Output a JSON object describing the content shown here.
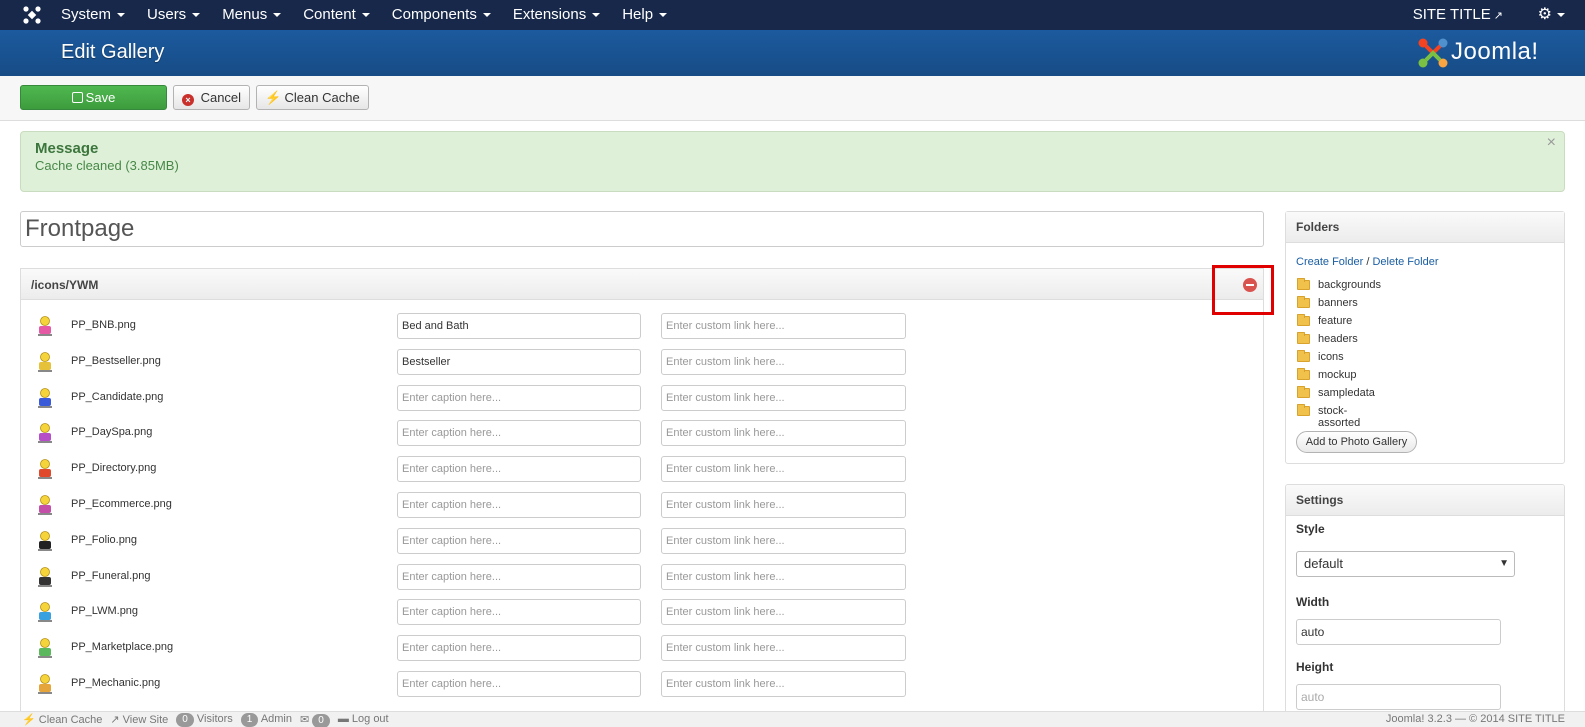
{
  "navbar": {
    "logo_icon": "joomla-icon",
    "menu": [
      "System",
      "Users",
      "Menus",
      "Content",
      "Components",
      "Extensions",
      "Help"
    ],
    "site_title": "SITE TITLE",
    "settings_icon": "gear-icon"
  },
  "header": {
    "title": "Edit Gallery",
    "brand": "Joomla!"
  },
  "toolbar": {
    "save_label": "Save",
    "cancel_label": "Cancel",
    "clean_cache_label": "Clean Cache"
  },
  "message": {
    "title": "Message",
    "text": "Cache cleaned (3.85MB)",
    "close": "×"
  },
  "gallery": {
    "title": "Frontpage",
    "folder_path": "/icons/YWM",
    "caption_placeholder": "Enter caption here...",
    "link_placeholder": "Enter custom link here...",
    "items": [
      {
        "file": "PP_BNB.png",
        "caption": "Bed and Bath",
        "link": "",
        "color": "#e65aa5"
      },
      {
        "file": "PP_Bestseller.png",
        "caption": "Bestseller",
        "link": "",
        "color": "#e6c23a"
      },
      {
        "file": "PP_Candidate.png",
        "caption": "",
        "link": "",
        "color": "#3a5bd9"
      },
      {
        "file": "PP_DaySpa.png",
        "caption": "",
        "link": "",
        "color": "#b64fc7"
      },
      {
        "file": "PP_Directory.png",
        "caption": "",
        "link": "",
        "color": "#e0492c"
      },
      {
        "file": "PP_Ecommerce.png",
        "caption": "",
        "link": "",
        "color": "#c44fa8"
      },
      {
        "file": "PP_Folio.png",
        "caption": "",
        "link": "",
        "color": "#222222"
      },
      {
        "file": "PP_Funeral.png",
        "caption": "",
        "link": "",
        "color": "#333333"
      },
      {
        "file": "PP_LWM.png",
        "caption": "",
        "link": "",
        "color": "#3aa1e0"
      },
      {
        "file": "PP_Marketplace.png",
        "caption": "",
        "link": "",
        "color": "#5cb85c"
      },
      {
        "file": "PP_Mechanic.png",
        "caption": "",
        "link": "",
        "color": "#e6a53a"
      }
    ]
  },
  "folders_panel": {
    "title": "Folders",
    "create_label": "Create Folder",
    "separator": "/",
    "delete_label": "Delete Folder",
    "folders": [
      "backgrounds",
      "banners",
      "feature",
      "headers",
      "icons",
      "mockup",
      "sampledata",
      "stock-assorted"
    ],
    "add_button": "Add to Photo Gallery"
  },
  "settings_panel": {
    "title": "Settings",
    "style_label": "Style",
    "style_value": "default",
    "width_label": "Width",
    "width_value": "auto",
    "height_label": "Height",
    "height_placeholder": "auto"
  },
  "statusbar": {
    "clean_cache": "Clean Cache",
    "view_site": "View Site",
    "visitors_count": "0",
    "visitors_label": "Visitors",
    "admin_count": "1",
    "admin_label": "Admin",
    "messages_count": "0",
    "logout": "Log out",
    "footer": "Joomla! 3.2.3 — © 2014 SITE TITLE"
  },
  "colors": {
    "navbar_bg": "#17284a",
    "header_bg": "#1a5596",
    "save_green": "#46a546",
    "alert_bg": "#dff0d8",
    "highlight_red": "#e00000"
  }
}
